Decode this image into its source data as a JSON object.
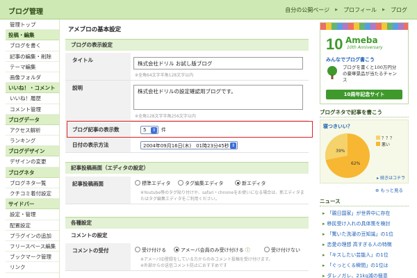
{
  "header": {
    "title": "ブログ管理",
    "nav": [
      "自分の公開ページ",
      "プロフィール",
      "ブログ"
    ]
  },
  "sidebar": {
    "items": [
      {
        "type": "item",
        "label": "管理トップ"
      },
      {
        "type": "head",
        "label": "投稿・編集"
      },
      {
        "type": "item",
        "label": "ブログを書く"
      },
      {
        "type": "item",
        "label": "記事の編集・削除"
      },
      {
        "type": "item",
        "label": "テーマ編集"
      },
      {
        "type": "item",
        "label": "画像フォルダ"
      },
      {
        "type": "head",
        "label": "いいね！・コメント"
      },
      {
        "type": "item",
        "label": "いいね！履歴"
      },
      {
        "type": "item",
        "label": "コメント管理"
      },
      {
        "type": "head",
        "label": "ブログデータ"
      },
      {
        "type": "item",
        "label": "アクセス解析"
      },
      {
        "type": "item",
        "label": "ランキング"
      },
      {
        "type": "head",
        "label": "ブログデザイン"
      },
      {
        "type": "item",
        "label": "デザインの変更"
      },
      {
        "type": "head",
        "label": "ブログネタ"
      },
      {
        "type": "item",
        "label": "ブログネタ一覧"
      },
      {
        "type": "item",
        "label": "クチコミ着付設定"
      },
      {
        "type": "head",
        "label": "サイドバー"
      },
      {
        "type": "item",
        "label": "設定・管理"
      },
      {
        "type": "item",
        "label": "配置設定"
      },
      {
        "type": "item",
        "label": "プラグインの追加"
      },
      {
        "type": "item",
        "label": "フリースペース編集"
      },
      {
        "type": "item",
        "label": "ブックマーク管理"
      },
      {
        "type": "item",
        "label": "リンク"
      }
    ]
  },
  "main": {
    "page_title": "アメブロの基本設定",
    "section_display": "ブログの表示設定",
    "title_label": "タイトル",
    "title_value": "株式会社ドリル お試し版ブログ",
    "title_hint": "※全角64文字半角128文字以内",
    "desc_label": "説明",
    "desc_value": "株式会社ドリルの設定確認用ブログです。",
    "desc_hint": "※全角128文字半角256文字以内",
    "count_label": "ブログ記事の表示数",
    "count_value": "5",
    "count_unit": "件",
    "date_label": "日付の表示方法",
    "date_value": "2004年09月16日(木)　01時23分45秒",
    "section_editor": "記事投稿画面（エディタの設定）",
    "editor_label": "記事投稿画面",
    "editor_options": [
      "標準エディタ",
      "タグ編集エディタ",
      "新エディタ"
    ],
    "editor_selected": 2,
    "editor_hint1": "※Youtube等のタグ貼り付けや、safari・chromeをお使いになる場合は、新エディタま",
    "editor_hint2": "たはタグ編集エディタをご利用ください。",
    "section_misc": "各種設定",
    "comment_settings": "コメントの設定",
    "comment_label": "コメントの受付",
    "comment_options": [
      "受け付ける",
      "アメーバ会員のみ受け付ける",
      "受け付けない"
    ],
    "comment_selected": 1,
    "comment_hint1": "※アメーバID登録をしている方からのみコメント投稿を受け付けます。",
    "comment_hint2": "※外部からの送信コメント防止におすすめです"
  },
  "right": {
    "ad_brand": "Ameba",
    "ad_anniv": "10th Anniversary",
    "ad_tagline": "みんなでブログ書こう",
    "ad_text1": "ブログを書くと100万円分",
    "ad_text2": "の豪華景品が当たるチャン",
    "ad_text3": "ス",
    "ad_button": "10周年記念サイト",
    "neta_head": "ブログネタで記事を書こう",
    "neta_question": "寝つきいい？",
    "neta_legend": [
      "？？？",
      "悪い"
    ],
    "neta_pct": [
      "39%",
      "62%"
    ],
    "neta_more": "続きはコチラ",
    "neta_more2": "もっと見る",
    "news_head": "ニュース",
    "news": [
      "「親日国家」が世界中に存在",
      "移民受け入れの具体策を検討",
      "「驚いた洗濯の豆知識」の1位",
      "恋愛の理想 高すぎる人の特徴",
      "「キスしたい芸能人」の1位",
      "「ぐっとくる瞬間」の1位は",
      "ダレノガレ、21kg減の極意",
      "「整形サイボーグ」の私生活"
    ]
  },
  "colors": {
    "header_bg": "#cfe9b4",
    "section_bg": "#e3f1d4",
    "highlight": "#e02020",
    "ameba_green": "#3f9a2b"
  }
}
